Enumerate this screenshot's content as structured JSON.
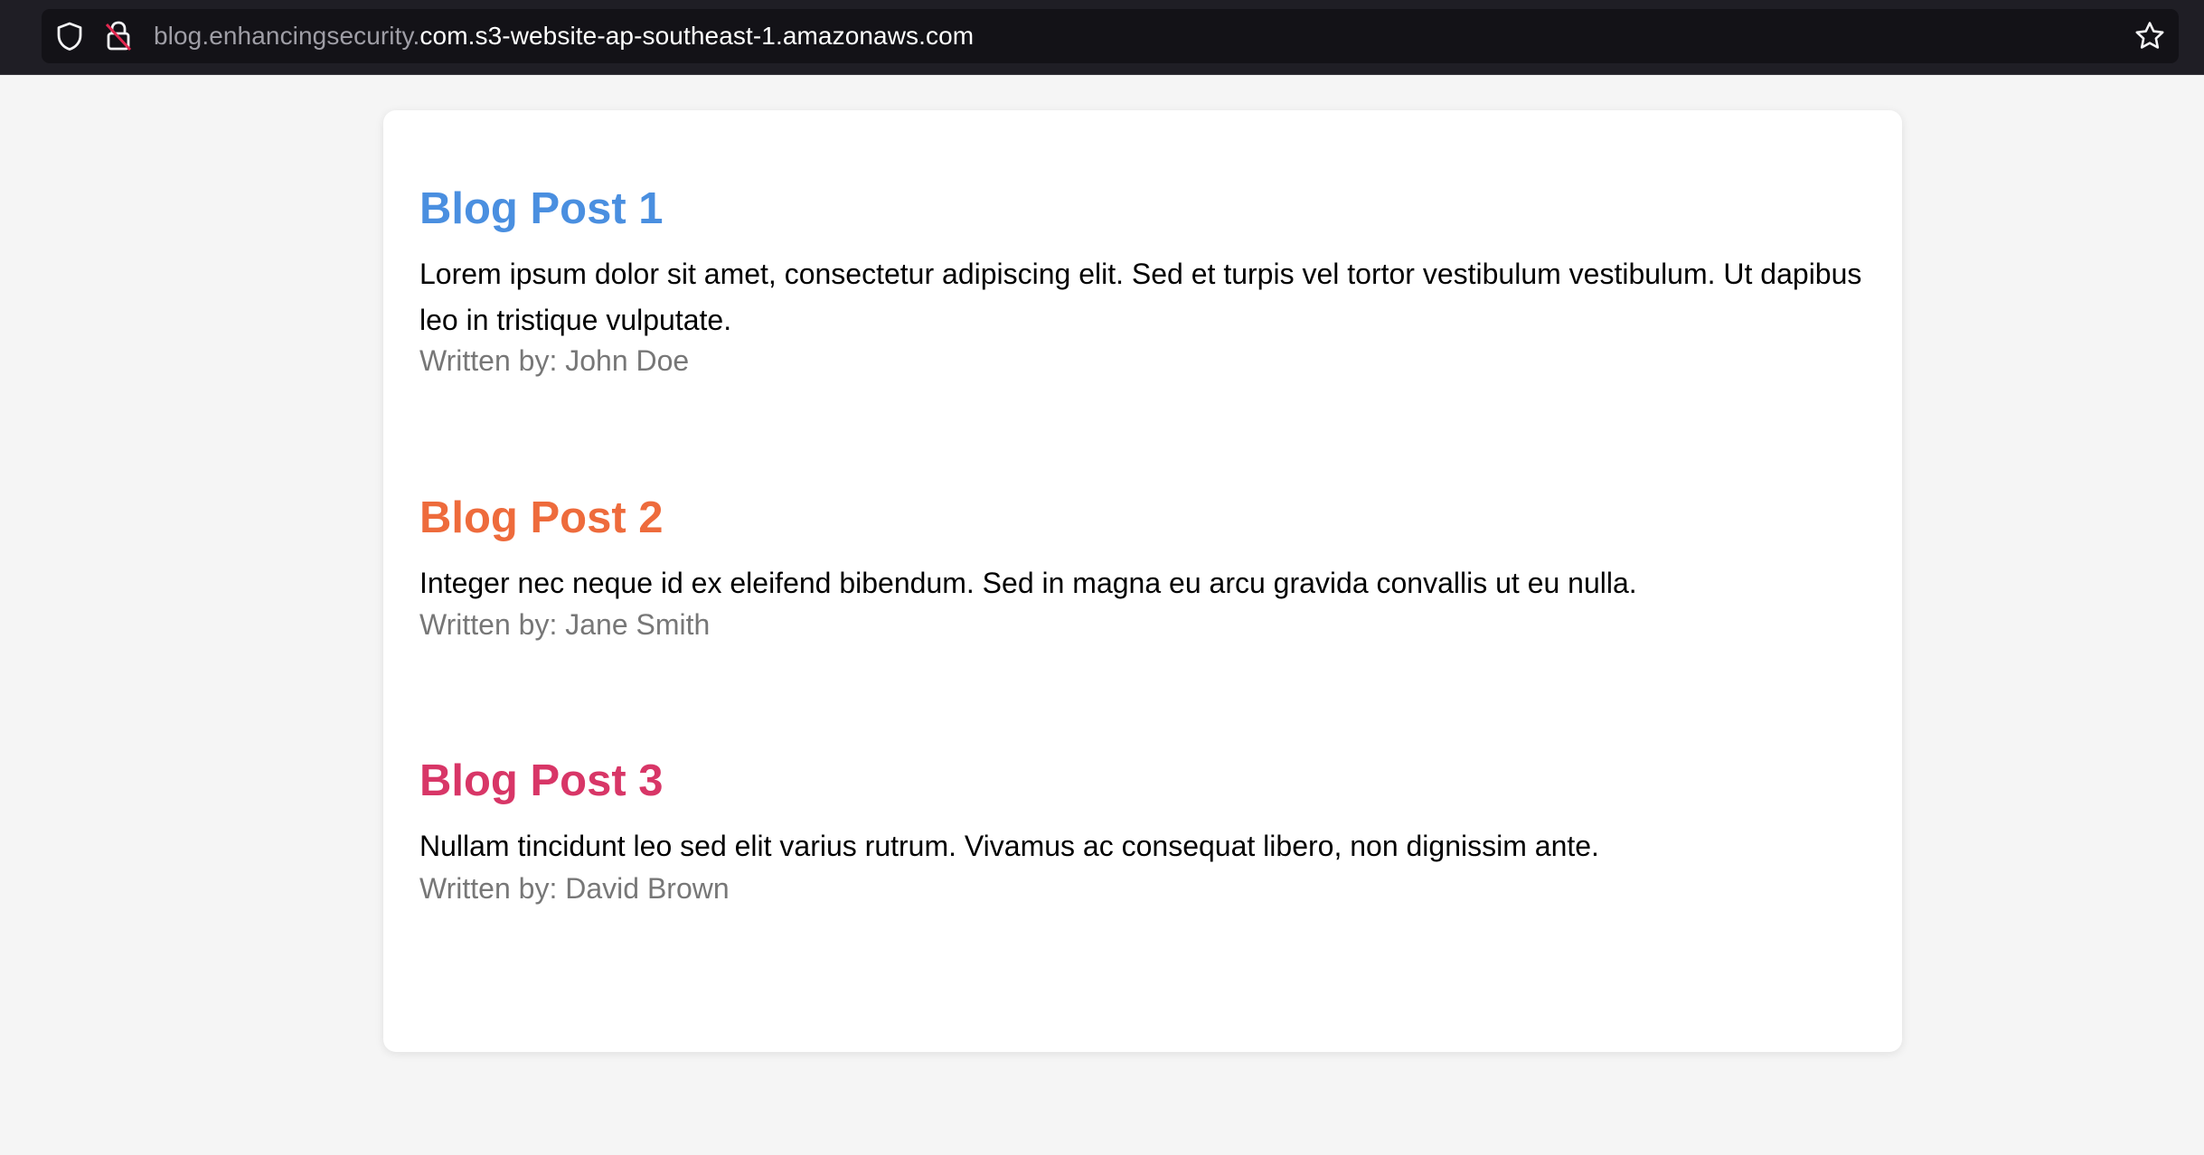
{
  "browser": {
    "url_prefix": "blog.enhancingsecurity.",
    "url_host": "com.s3-website-ap-southeast-1.amazonaws.com",
    "icons": [
      "shield-icon",
      "insecure-lock-icon",
      "bookmark-star-icon"
    ]
  },
  "posts": [
    {
      "title": "Blog Post 1",
      "title_color": "#4a8fe0",
      "body": "Lorem ipsum dolor sit amet, consectetur adipiscing elit. Sed et turpis vel tortor vestibulum vestibulum. Ut dapibus leo in tristique vulputate.",
      "author": "Written by: John Doe"
    },
    {
      "title": "Blog Post 2",
      "title_color": "#ee6b3c",
      "body": "Integer nec neque id ex eleifend bibendum. Sed in magna eu arcu gravida convallis ut eu nulla.",
      "author": "Written by: Jane Smith"
    },
    {
      "title": "Blog Post 3",
      "title_color": "#d83667",
      "body": "Nullam tincidunt leo sed elit varius rutrum. Vivamus ac consequat libero, non dignissim ante.",
      "author": "Written by: David Brown"
    }
  ]
}
